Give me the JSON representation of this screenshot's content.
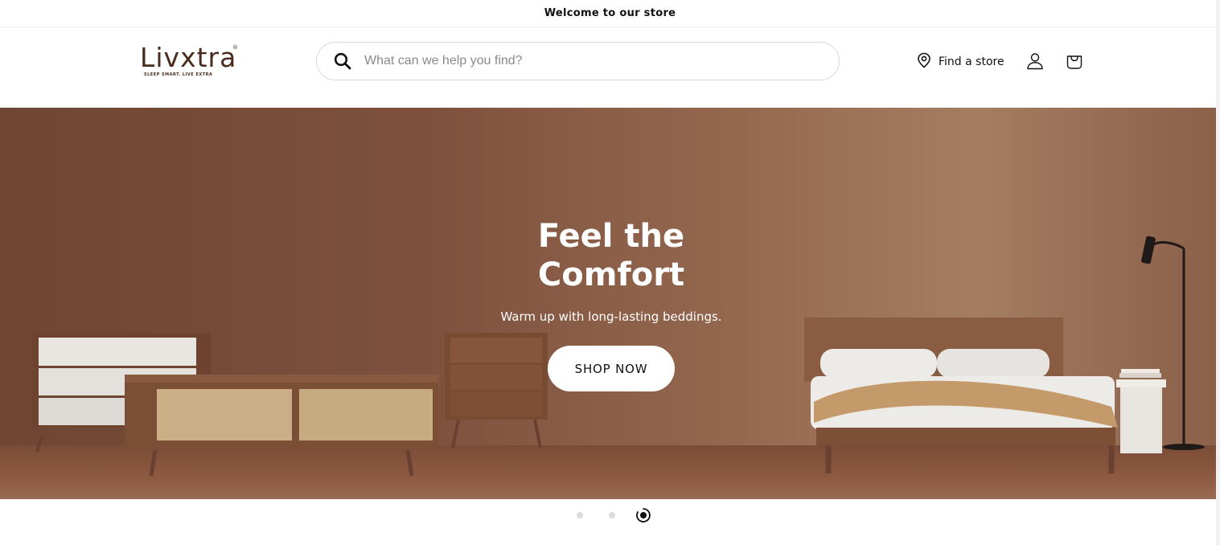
{
  "announcement": {
    "text": "Welcome to our store"
  },
  "header": {
    "logo": {
      "name": "Livxtra",
      "tagline": "SLEEP SMART. LIVE EXTRA",
      "registered": "®"
    },
    "search": {
      "placeholder": "What can we help you find?",
      "value": ""
    },
    "find_store_label": "Find a store",
    "icons": {
      "search": "search-icon",
      "location": "location-pin-icon",
      "account": "user-icon",
      "cart": "shopping-bag-icon"
    }
  },
  "hero": {
    "title_line1": "Feel the",
    "title_line2": "Comfort",
    "subtitle": "Warm up with long-lasting beddings.",
    "cta_label": "SHOP NOW",
    "background_color": "#7d513d"
  },
  "carousel": {
    "slide_count": 3,
    "active_index": 3
  }
}
